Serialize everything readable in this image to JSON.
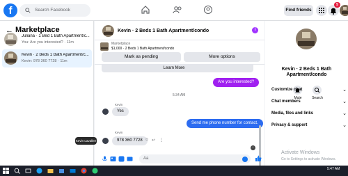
{
  "topnav": {
    "search_placeholder": "Search Facebook",
    "find_friends": "Find friends",
    "notification_count": "5"
  },
  "left": {
    "title": "Marketplace",
    "conversations": [
      {
        "title": "Juliana · 1 Bed 1 Bath Apartment/c...",
        "subtitle": "You: Are you interested? · 11m",
        "active": false
      },
      {
        "title": "Kevin · 2 Beds 1 Bath Apartment/c...",
        "subtitle": "Kevin: 978 360 7728 · 11m",
        "active": true
      }
    ]
  },
  "chat": {
    "header_name": "Kevin · 2 Beds 1 Bath Apartment/condo",
    "item_label": "Marketplace",
    "item_detail": "$1,000 · 2 Beds 1 Bath Apartment/condo",
    "mark_pending": "Mark as pending",
    "more_options": "More options",
    "learn_more": "Learn More",
    "messages": {
      "out1": "Are you interested?",
      "time": "5:34 AM",
      "sender1": "Kevin",
      "in1": "Yes",
      "out2": "Send me phone number for contact.",
      "sender2": "Kevin",
      "in2": "978 360 7728"
    },
    "tooltip": "Kevin Lavallee",
    "composer_placeholder": "Aa"
  },
  "right": {
    "name": "Kevin · 2 Beds 1 Bath Apartment/condo",
    "mute": "Mute",
    "search": "Search",
    "rows": [
      "Customize chat",
      "Chat members",
      "Media, files and links",
      "Privacy & support"
    ]
  },
  "watermark": {
    "line1": "Activate Windows",
    "line2": "Go to Settings to activate Windows."
  },
  "taskbar": {
    "time": "5:47 AM",
    "date": ""
  },
  "colors": {
    "brand": "#1877f2",
    "outgoing": "#a020f0",
    "outgoing2": "#2d6cf0"
  }
}
